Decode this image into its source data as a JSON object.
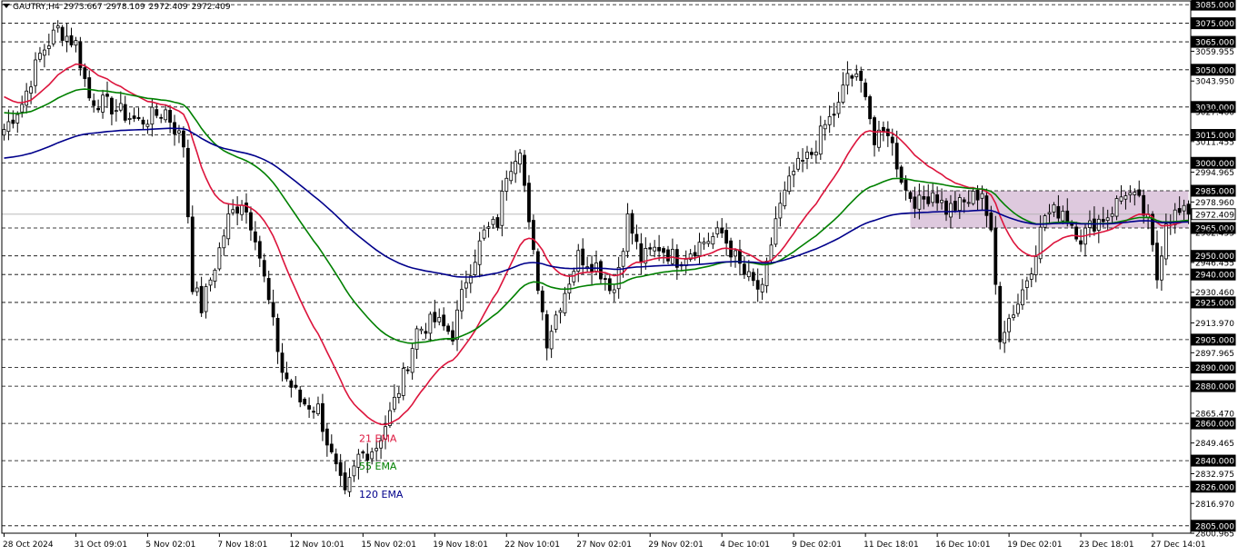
{
  "header": {
    "symbol": "GAUTRY,H4",
    "open": "2973.667",
    "high": "2978.109",
    "low": "2972.409",
    "close": "2972.409"
  },
  "chart_data": {
    "type": "candlestick",
    "ylim": [
      2801,
      3087
    ],
    "price_axis_labels": [
      {
        "value": 3085.0,
        "text": "3085.000",
        "boxed": true
      },
      {
        "value": 3075.0,
        "text": "3075.000",
        "boxed": true
      },
      {
        "value": 3065.0,
        "text": "3065.000",
        "boxed": true
      },
      {
        "value": 3059.955,
        "text": "3059.955",
        "boxed": false
      },
      {
        "value": 3050.0,
        "text": "3050.000",
        "boxed": true
      },
      {
        "value": 3043.95,
        "text": "3043.950",
        "boxed": false
      },
      {
        "value": 3030.0,
        "text": "3030.000",
        "boxed": true
      },
      {
        "value": 3027.46,
        "text": "3027.460",
        "boxed": false
      },
      {
        "value": 3015.0,
        "text": "3015.000",
        "boxed": true
      },
      {
        "value": 3011.455,
        "text": "3011.455",
        "boxed": false
      },
      {
        "value": 3000.0,
        "text": "3000.000",
        "boxed": true
      },
      {
        "value": 2994.965,
        "text": "2994.965",
        "boxed": false
      },
      {
        "value": 2985.0,
        "text": "2985.000",
        "boxed": true
      },
      {
        "value": 2978.96,
        "text": "2978.960",
        "boxed": false
      },
      {
        "value": 2972.409,
        "text": "2972.409",
        "boxed": true,
        "current": true
      },
      {
        "value": 2965.0,
        "text": "2965.000",
        "boxed": true
      },
      {
        "value": 2962.455,
        "text": "2962.455",
        "boxed": false
      },
      {
        "value": 2950.0,
        "text": "2950.000",
        "boxed": true
      },
      {
        "value": 2946.455,
        "text": "2946.455",
        "boxed": false
      },
      {
        "value": 2940.0,
        "text": "2940.000",
        "boxed": true
      },
      {
        "value": 2930.46,
        "text": "2930.460",
        "boxed": false
      },
      {
        "value": 2925.0,
        "text": "2925.000",
        "boxed": true
      },
      {
        "value": 2913.97,
        "text": "2913.970",
        "boxed": false
      },
      {
        "value": 2905.0,
        "text": "2905.000",
        "boxed": true
      },
      {
        "value": 2897.965,
        "text": "2897.965",
        "boxed": false
      },
      {
        "value": 2890.0,
        "text": "2890.000",
        "boxed": true
      },
      {
        "value": 2880.0,
        "text": "2880.000",
        "boxed": true
      },
      {
        "value": 2865.47,
        "text": "2865.470",
        "boxed": false
      },
      {
        "value": 2860.0,
        "text": "2860.000",
        "boxed": true
      },
      {
        "value": 2849.465,
        "text": "2849.465",
        "boxed": false
      },
      {
        "value": 2840.0,
        "text": "2840.000",
        "boxed": true
      },
      {
        "value": 2832.975,
        "text": "2832.975",
        "boxed": false
      },
      {
        "value": 2826.0,
        "text": "2826.000",
        "boxed": true
      },
      {
        "value": 2816.97,
        "text": "2816.970",
        "boxed": false
      },
      {
        "value": 2805.0,
        "text": "2805.000",
        "boxed": true
      },
      {
        "value": 2800.965,
        "text": "2800.965",
        "boxed": false
      }
    ],
    "horizontal_levels": [
      3085,
      3075,
      3065,
      3050,
      3030,
      3015,
      3000,
      2985,
      2965,
      2950,
      2940,
      2925,
      2905,
      2890,
      2880,
      2860,
      2840,
      2826,
      2805
    ],
    "current_price": 2972.409,
    "x_labels": [
      {
        "bar": 0,
        "text": "28 Oct 2024"
      },
      {
        "bar": 16,
        "text": "31 Oct 09:01"
      },
      {
        "bar": 32,
        "text": "5 Nov 02:01"
      },
      {
        "bar": 48,
        "text": "7 Nov 18:01"
      },
      {
        "bar": 64,
        "text": "12 Nov 10:01"
      },
      {
        "bar": 80,
        "text": "15 Nov 02:01"
      },
      {
        "bar": 96,
        "text": "19 Nov 18:01"
      },
      {
        "bar": 112,
        "text": "22 Nov 10:01"
      },
      {
        "bar": 128,
        "text": "27 Nov 02:01"
      },
      {
        "bar": 144,
        "text": "29 Nov 02:01"
      },
      {
        "bar": 160,
        "text": "4 Dec 10:01"
      },
      {
        "bar": 176,
        "text": "9 Dec 02:01"
      },
      {
        "bar": 192,
        "text": "11 Dec 18:01"
      },
      {
        "bar": 208,
        "text": "16 Dec 10:01"
      },
      {
        "bar": 224,
        "text": "19 Dec 02:01"
      },
      {
        "bar": 240,
        "text": "23 Dec 18:01"
      },
      {
        "bar": 256,
        "text": "27 Dec 14:01"
      }
    ],
    "price_path": [
      [
        0,
        3018
      ],
      [
        4,
        3032
      ],
      [
        8,
        3058
      ],
      [
        12,
        3072
      ],
      [
        16,
        3064
      ],
      [
        19,
        3035
      ],
      [
        24,
        3030
      ],
      [
        30,
        3022
      ],
      [
        36,
        3028
      ],
      [
        40,
        3010
      ],
      [
        42,
        2935
      ],
      [
        44,
        2922
      ],
      [
        47,
        2945
      ],
      [
        50,
        2970
      ],
      [
        53,
        2980
      ],
      [
        56,
        2962
      ],
      [
        59,
        2925
      ],
      [
        62,
        2888
      ],
      [
        66,
        2872
      ],
      [
        70,
        2868
      ],
      [
        73,
        2842
      ],
      [
        76,
        2820
      ],
      [
        79,
        2842
      ],
      [
        83,
        2848
      ],
      [
        86,
        2865
      ],
      [
        89,
        2885
      ],
      [
        92,
        2910
      ],
      [
        96,
        2915
      ],
      [
        100,
        2908
      ],
      [
        103,
        2938
      ],
      [
        107,
        2962
      ],
      [
        110,
        2968
      ],
      [
        112,
        2995
      ],
      [
        115,
        3010
      ],
      [
        117,
        2965
      ],
      [
        119,
        2935
      ],
      [
        121,
        2905
      ],
      [
        124,
        2925
      ],
      [
        128,
        2950
      ],
      [
        132,
        2945
      ],
      [
        136,
        2932
      ],
      [
        139,
        2970
      ],
      [
        142,
        2948
      ],
      [
        146,
        2955
      ],
      [
        150,
        2948
      ],
      [
        156,
        2958
      ],
      [
        160,
        2962
      ],
      [
        165,
        2940
      ],
      [
        169,
        2930
      ],
      [
        172,
        2970
      ],
      [
        176,
        2995
      ],
      [
        180,
        3005
      ],
      [
        183,
        3020
      ],
      [
        186,
        3030
      ],
      [
        188,
        3048
      ],
      [
        192,
        3040
      ],
      [
        194,
        3010
      ],
      [
        197,
        3018
      ],
      [
        199,
        3000
      ],
      [
        201,
        2985
      ],
      [
        204,
        2978
      ],
      [
        207,
        2985
      ],
      [
        210,
        2975
      ],
      [
        214,
        2978
      ],
      [
        218,
        2985
      ],
      [
        220,
        2960
      ],
      [
        222,
        2908
      ],
      [
        226,
        2925
      ],
      [
        229,
        2945
      ],
      [
        232,
        2972
      ],
      [
        236,
        2975
      ],
      [
        240,
        2960
      ],
      [
        243,
        2968
      ],
      [
        246,
        2972
      ],
      [
        250,
        2985
      ],
      [
        253,
        2978
      ],
      [
        255,
        2968
      ],
      [
        257,
        2938
      ],
      [
        259,
        2970
      ],
      [
        261,
        2972.409
      ]
    ],
    "indicators": [
      {
        "name": "21 EMA",
        "color": "#dc143c",
        "period": 21
      },
      {
        "name": "55 EMA",
        "color": "#008000",
        "period": 55
      },
      {
        "name": "120 EMA",
        "color": "#00008b",
        "period": 120
      }
    ],
    "rectangle_zone": {
      "from_bar": 202,
      "to_bar": 264,
      "top": 2985,
      "bottom": 2965,
      "color": "#d8bfd8"
    },
    "colors": {
      "background": "#ffffff",
      "candles": "#000000",
      "grid": "#000000",
      "axis_text": "#000000"
    }
  }
}
